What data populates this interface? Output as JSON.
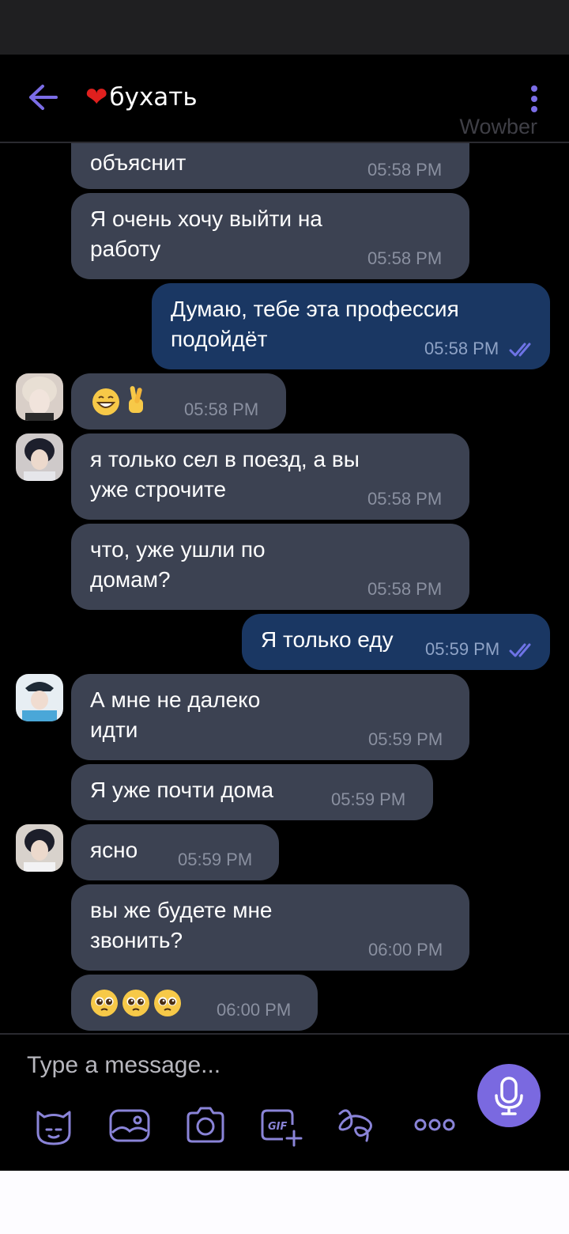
{
  "header": {
    "title": "бухать",
    "heart": "❤",
    "watermark": "Wowber"
  },
  "messages": [
    {
      "text": "объяснит",
      "time": "05:58 PM"
    },
    {
      "text": "Я очень хочу выйти на\nработу",
      "time": "05:58 PM"
    },
    {
      "text": "Думаю, тебе эта профессия\nподойдёт",
      "time": "05:58 PM"
    },
    {
      "text": "",
      "time": "05:58 PM",
      "emoji": [
        "grinning-face",
        "crossed-fingers"
      ]
    },
    {
      "text": "я только сел в поезд, а вы\nуже строчите",
      "time": "05:58 PM"
    },
    {
      "text": "что, уже ушли по\nдомам?",
      "time": "05:58 PM"
    },
    {
      "text": "Я только еду",
      "time": "05:59 PM"
    },
    {
      "text": "А мне не далеко\nидти",
      "time": "05:59 PM"
    },
    {
      "text": "Я уже почти дома",
      "time": "05:59 PM"
    },
    {
      "text": "ясно",
      "time": "05:59 PM"
    },
    {
      "text": "вы же будете мне\nзвонить?",
      "time": "06:00 PM"
    },
    {
      "text": "",
      "time": "06:00 PM",
      "emoji": [
        "pleading-face",
        "pleading-face",
        "pleading-face"
      ]
    }
  ],
  "composer": {
    "placeholder": "Type a message..."
  },
  "colors": {
    "incoming": "#3c4252",
    "outgoing": "#1a3763",
    "accent": "#7a69e0",
    "ticks": "#6e73e6"
  },
  "icons": [
    "back-arrow-icon",
    "kebab-menu-icon",
    "sticker-icon",
    "gallery-icon",
    "camera-icon",
    "gif-icon",
    "doodle-icon",
    "more-icon",
    "microphone-icon",
    "read-ticks-icon"
  ]
}
